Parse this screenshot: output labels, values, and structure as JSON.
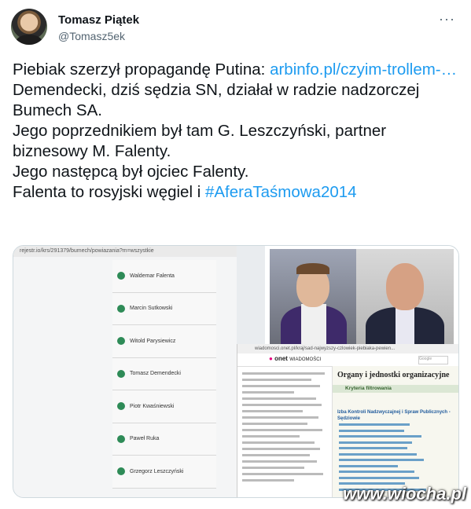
{
  "author": {
    "name": "Tomasz Piątek",
    "handle": "@Tomasz5ek"
  },
  "tweet": {
    "line1_text": "Piebiak szerzył propagandę Putina: ",
    "line1_link": "arbinfo.pl/czyim-trollem-…",
    "line2": "Demendecki, dziś sędzia SN, działał w radzie nadzorczej Bumech SA.",
    "line3": "Jego poprzednikiem był tam G. Leszczyński, partner biznesowy M. Falenty.",
    "line4": "Jego następcą był ojciec Falenty.",
    "line5_text": "Falenta to rosyjski węgiel i ",
    "line5_hashtag": "#AferaTaśmowa2014"
  },
  "media": {
    "left_url": "rejestr.io/krs/291379/bumech/powiazania?m=wszystkie",
    "people": [
      "Waldemar Falenta",
      "Marcin Sutkowski",
      "Witold Parysiewicz",
      "Tomasz Demendecki",
      "Piotr Kwaśniewski",
      "Paweł Ruka",
      "Grzegorz Leszczyński"
    ],
    "doc_url": "wiadomosci.onet.pl/kraj/sad-najwyzszy-czlowiek-piebiaka-pewien...",
    "onet_logo": "onet",
    "onet_section": "WIADOMOŚCI",
    "search_placeholder": "Google",
    "organ_title": "Organy i jednostki organizacyjne",
    "filter_title": "Kryteria filtrowania",
    "izba_title": "Izba Kontroli Nadzwyczajnej i Spraw Publicznych - Sędziowie"
  },
  "watermark": "www.wiocha.pl",
  "icons": {
    "more": "more-horizontal-icon",
    "person": "person-icon"
  },
  "colors": {
    "link": "#1d9bf0",
    "handle": "#536471",
    "person_icon": "#2e8b57"
  }
}
